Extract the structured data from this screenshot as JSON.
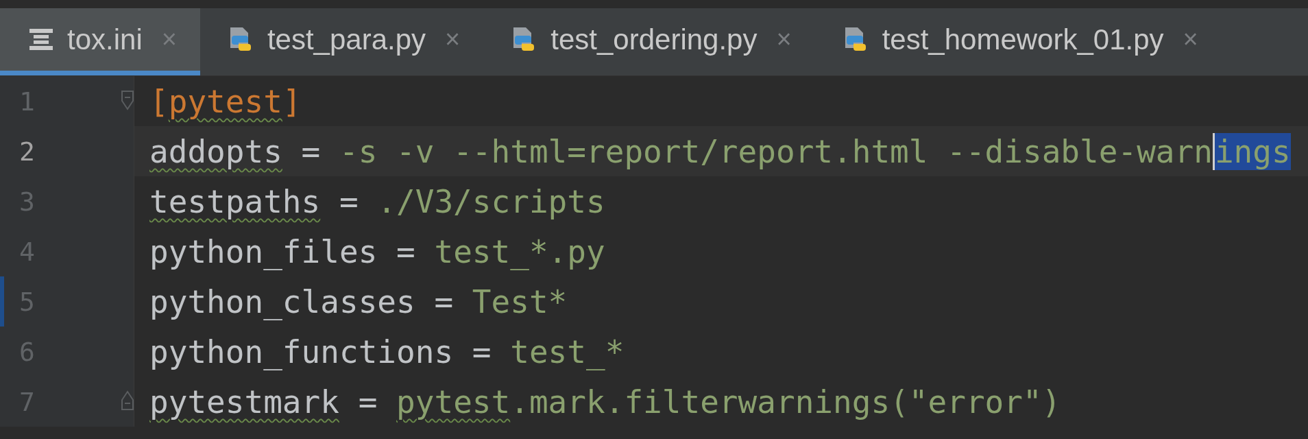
{
  "tabs": [
    {
      "label": "tox.ini",
      "kind": "ini",
      "selected": true,
      "close": "×"
    },
    {
      "label": "test_para.py",
      "kind": "python",
      "selected": false,
      "close": "×"
    },
    {
      "label": "test_ordering.py",
      "kind": "python",
      "selected": false,
      "close": "×"
    },
    {
      "label": "test_homework_01.py",
      "kind": "python",
      "selected": false,
      "close": "×"
    }
  ],
  "editor": {
    "lines": [
      {
        "number": "1",
        "current": false,
        "marker": false,
        "kind": "fold-start",
        "segments": [
          {
            "text": "[",
            "kind": "section",
            "squiggle": false,
            "selected": false
          },
          {
            "text": "pytest",
            "kind": "section",
            "squiggle": true,
            "selected": false
          },
          {
            "text": "]",
            "kind": "section",
            "squiggle": false,
            "selected": false
          }
        ]
      },
      {
        "number": "2",
        "current": true,
        "marker": false,
        "kind": "plain",
        "segments": [
          {
            "text": "addopts",
            "kind": "key",
            "squiggle": true,
            "selected": false
          },
          {
            "text": " = ",
            "kind": "op",
            "squiggle": false,
            "selected": false
          },
          {
            "text": "-s -v --html=report/report.html --disable-warn",
            "kind": "value",
            "squiggle": false,
            "selected": false
          },
          {
            "text": "ings",
            "kind": "value",
            "squiggle": false,
            "selected": true
          }
        ]
      },
      {
        "number": "3",
        "current": false,
        "marker": false,
        "kind": "plain",
        "segments": [
          {
            "text": "testpaths",
            "kind": "key",
            "squiggle": true,
            "selected": false
          },
          {
            "text": " = ",
            "kind": "op",
            "squiggle": false,
            "selected": false
          },
          {
            "text": "./V3/scripts",
            "kind": "value",
            "squiggle": false,
            "selected": false
          }
        ]
      },
      {
        "number": "4",
        "current": false,
        "marker": false,
        "kind": "plain",
        "segments": [
          {
            "text": "python_files",
            "kind": "key",
            "squiggle": false,
            "selected": false
          },
          {
            "text": " = ",
            "kind": "op",
            "squiggle": false,
            "selected": false
          },
          {
            "text": "test_*.py",
            "kind": "value",
            "squiggle": false,
            "selected": false
          }
        ]
      },
      {
        "number": "5",
        "current": false,
        "marker": true,
        "kind": "plain",
        "segments": [
          {
            "text": "python_classes",
            "kind": "key",
            "squiggle": false,
            "selected": false
          },
          {
            "text": " = ",
            "kind": "op",
            "squiggle": false,
            "selected": false
          },
          {
            "text": "Test*",
            "kind": "value",
            "squiggle": false,
            "selected": false
          }
        ]
      },
      {
        "number": "6",
        "current": false,
        "marker": false,
        "kind": "plain",
        "segments": [
          {
            "text": "python_functions",
            "kind": "key",
            "squiggle": false,
            "selected": false
          },
          {
            "text": " = ",
            "kind": "op",
            "squiggle": false,
            "selected": false
          },
          {
            "text": "test_*",
            "kind": "value",
            "squiggle": false,
            "selected": false
          }
        ]
      },
      {
        "number": "7",
        "current": false,
        "marker": false,
        "kind": "fold-end",
        "segments": [
          {
            "text": "pytestmark",
            "kind": "key",
            "squiggle": true,
            "selected": false
          },
          {
            "text": " = ",
            "kind": "op",
            "squiggle": false,
            "selected": false
          },
          {
            "text": "pytest",
            "kind": "value",
            "squiggle": true,
            "selected": false
          },
          {
            "text": ".mark.filterwarnings(\"error\")",
            "kind": "value",
            "squiggle": false,
            "selected": false
          }
        ]
      }
    ]
  }
}
